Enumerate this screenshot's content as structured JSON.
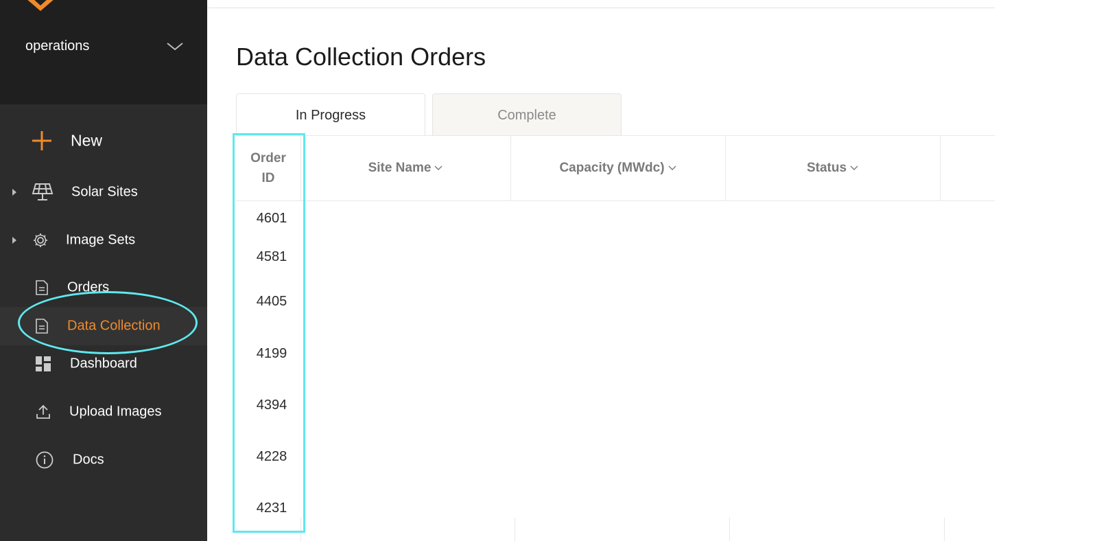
{
  "sidebar": {
    "workspace": "operations",
    "items": [
      {
        "label": "New",
        "icon": "plus-icon"
      },
      {
        "label": "Solar Sites",
        "icon": "solar-panel-icon"
      },
      {
        "label": "Image Sets",
        "icon": "gear-icon"
      },
      {
        "label": "Orders",
        "icon": "document-icon"
      },
      {
        "label": "Data Collection",
        "icon": "document-icon",
        "active": true
      },
      {
        "label": "Dashboard",
        "icon": "dashboard-icon"
      },
      {
        "label": "Upload Images",
        "icon": "upload-icon"
      },
      {
        "label": "Docs",
        "icon": "info-icon"
      }
    ]
  },
  "main": {
    "title": "Data Collection Orders",
    "tabs": [
      {
        "label": "In Progress",
        "active": true
      },
      {
        "label": "Complete",
        "active": false
      }
    ],
    "table": {
      "headers": {
        "order_id_line1": "Order",
        "order_id_line2": "ID",
        "site_name": "Site Name",
        "capacity": "Capacity (MWdc)",
        "status": "Status"
      },
      "order_ids": [
        "4601",
        "4581",
        "4405",
        "4199",
        "4394",
        "4228",
        "4231"
      ]
    }
  },
  "colors": {
    "sidebar_bg": "#2c2c2c",
    "sidebar_top_bg": "#1f1f1f",
    "accent": "#f08a2c",
    "highlight": "#5fe8ee"
  }
}
